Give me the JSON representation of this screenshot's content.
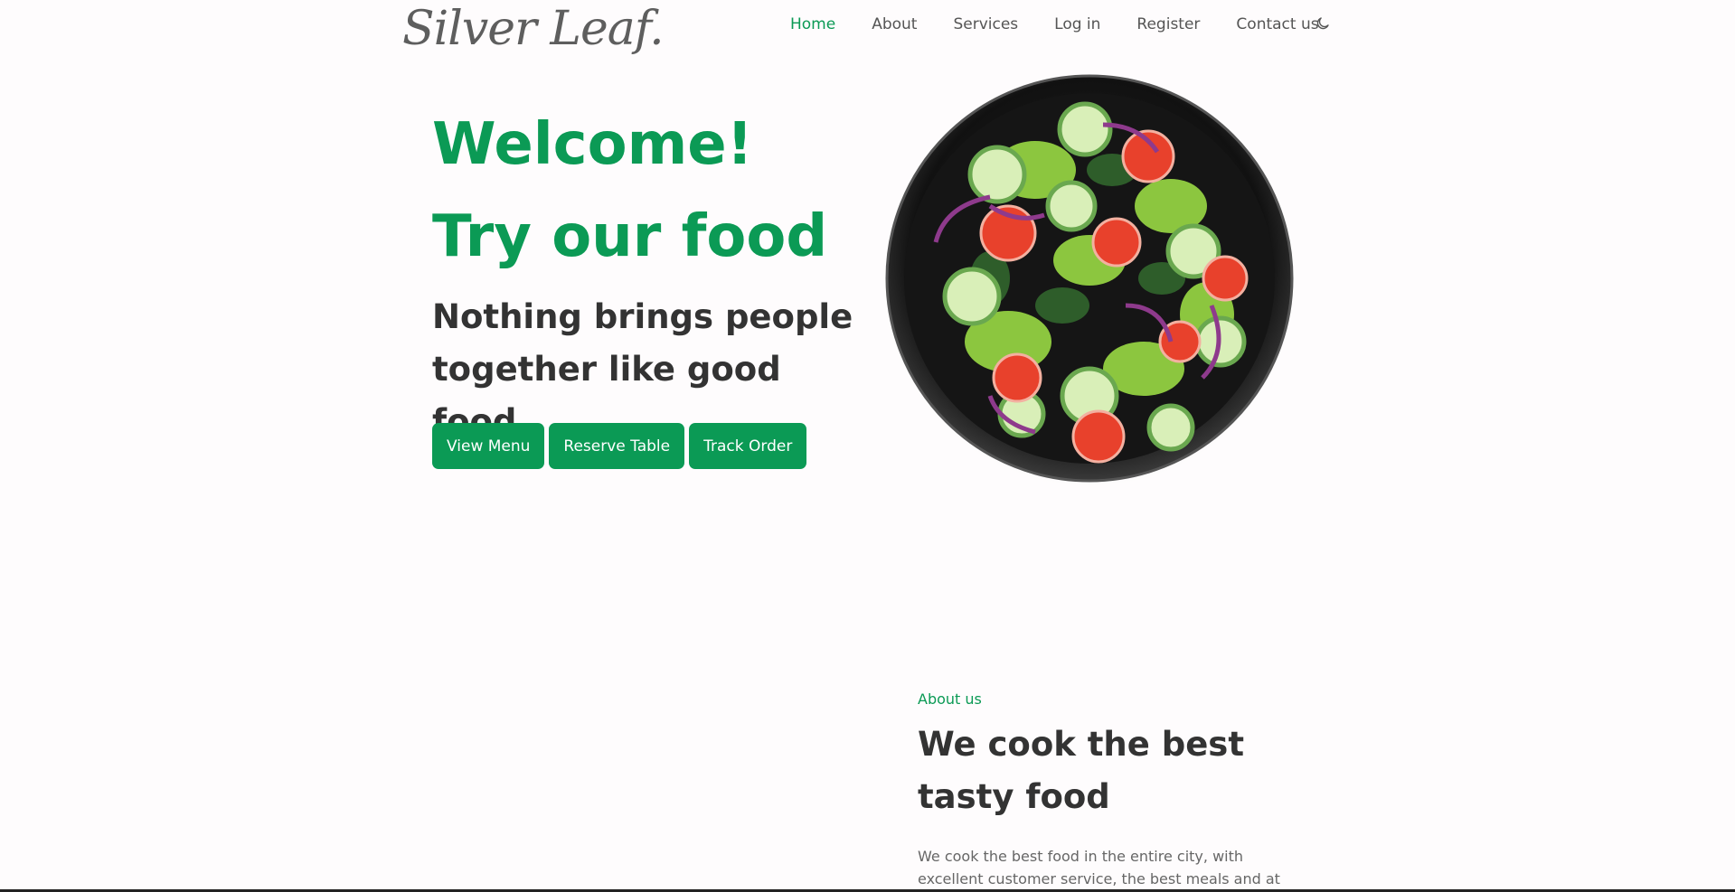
{
  "brand": {
    "logo_text": "Silver Leaf."
  },
  "nav": {
    "items": [
      {
        "label": "Home",
        "active": true
      },
      {
        "label": "About",
        "active": false
      },
      {
        "label": "Services",
        "active": false
      },
      {
        "label": "Log in",
        "active": false
      },
      {
        "label": "Register",
        "active": false
      },
      {
        "label": "Contact us",
        "active": false
      }
    ],
    "theme_toggle_icon": "moon-icon"
  },
  "hero": {
    "title_line1": "Welcome!",
    "title_line2": "Try our food",
    "subtitle": "Nothing brings people together like good food.",
    "buttons": {
      "view_menu": "View Menu",
      "reserve_table": "Reserve Table",
      "track_order": "Track Order"
    },
    "image": "salad-bowl"
  },
  "about": {
    "label": "About us",
    "title": "We cook the best tasty food",
    "text": "We cook the best food in the entire city, with excellent customer service, the best meals and at"
  },
  "colors": {
    "accent": "#0b9a55",
    "text_dark": "#333333",
    "background": "#fefcfd"
  }
}
